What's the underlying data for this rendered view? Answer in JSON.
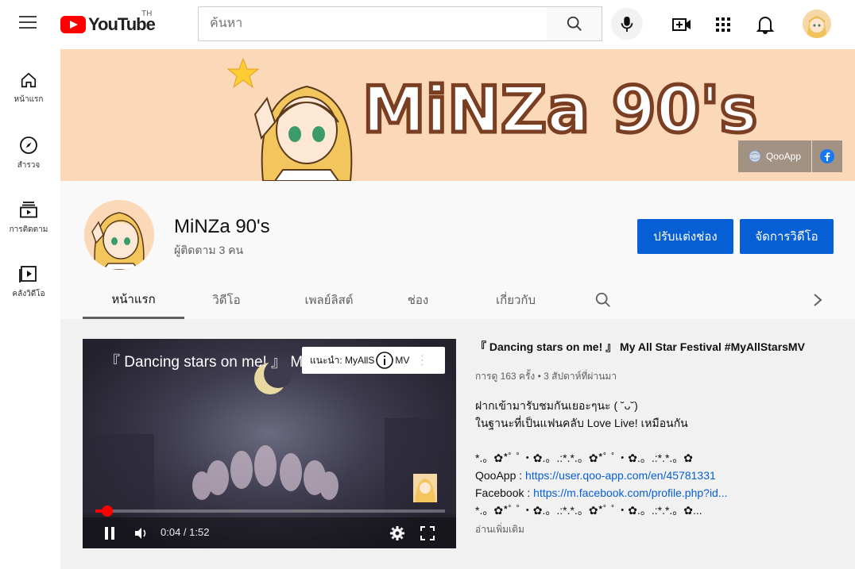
{
  "topbar": {
    "logo_text": "YouTube",
    "country": "TH",
    "search_placeholder": "ค้นหา"
  },
  "sidebar": {
    "items": [
      {
        "label": "หน้าแรก",
        "icon": "home-icon"
      },
      {
        "label": "สำรวจ",
        "icon": "compass-icon"
      },
      {
        "label": "การติดตาม",
        "icon": "subscriptions-icon"
      },
      {
        "label": "คลังวิดีโอ",
        "icon": "library-icon"
      }
    ]
  },
  "banner": {
    "title": "MiNZa 90's",
    "links": [
      {
        "label": "QooApp",
        "icon": "globe-icon"
      },
      {
        "label": "",
        "icon": "facebook-icon"
      }
    ],
    "background": "#fbd8b7"
  },
  "channel": {
    "name": "MiNZa 90's",
    "subscribers": "ผู้ติดตาม 3 คน",
    "customize_button": "ปรับแต่งช่อง",
    "manage_button": "จัดการวิดีโอ",
    "tabs": [
      {
        "label": "หน้าแรก",
        "active": true
      },
      {
        "label": "วิดีโอ",
        "active": false
      },
      {
        "label": "เพลย์ลิสต์",
        "active": false
      },
      {
        "label": "ช่อง",
        "active": false
      },
      {
        "label": "เกี่ยวกับ",
        "active": false
      }
    ]
  },
  "player": {
    "overlay_title": "『 Dancing stars on me! 』 My ",
    "suggest_text": "แนะนำ: MyAllS",
    "suggest_tail": "MV",
    "time": "0:04 / 1:52",
    "progress": 0.035
  },
  "video": {
    "title": "『 Dancing stars on me! 』 My All Star Festival #MyAllStarsMV",
    "meta": "การดู 163 ครั้ง • 3 สัปดาห์ที่ผ่านมา",
    "desc_line1": "ฝากเข้ามารับชมกันเยอะๆนะ ( ˘ᴗ˘)",
    "desc_line2": "ในฐานะที่เป็นแฟนคลับ Love Live! เหมือนกัน",
    "deco_line": "*.。✿*ﾟ ﾟ・✿.。.:*.*.。✿*ﾟ ﾟ・✿.。.:*.*.。✿",
    "qooapp_label": "QooApp : ",
    "qooapp_link": "https://user.qoo-app.com/en/45781331",
    "facebook_label": "Facebook : ",
    "facebook_link": "https://m.facebook.com/profile.php?id...",
    "deco_line2": "*.。✿*ﾟ ﾟ・✿.。.:*.*.。✿*ﾟ ﾟ・✿.。.:*.*.。✿...",
    "read_more": "อ่านเพิ่มเติม"
  },
  "colors": {
    "accent_blue": "#065fd4",
    "youtube_red": "#ff0000"
  }
}
